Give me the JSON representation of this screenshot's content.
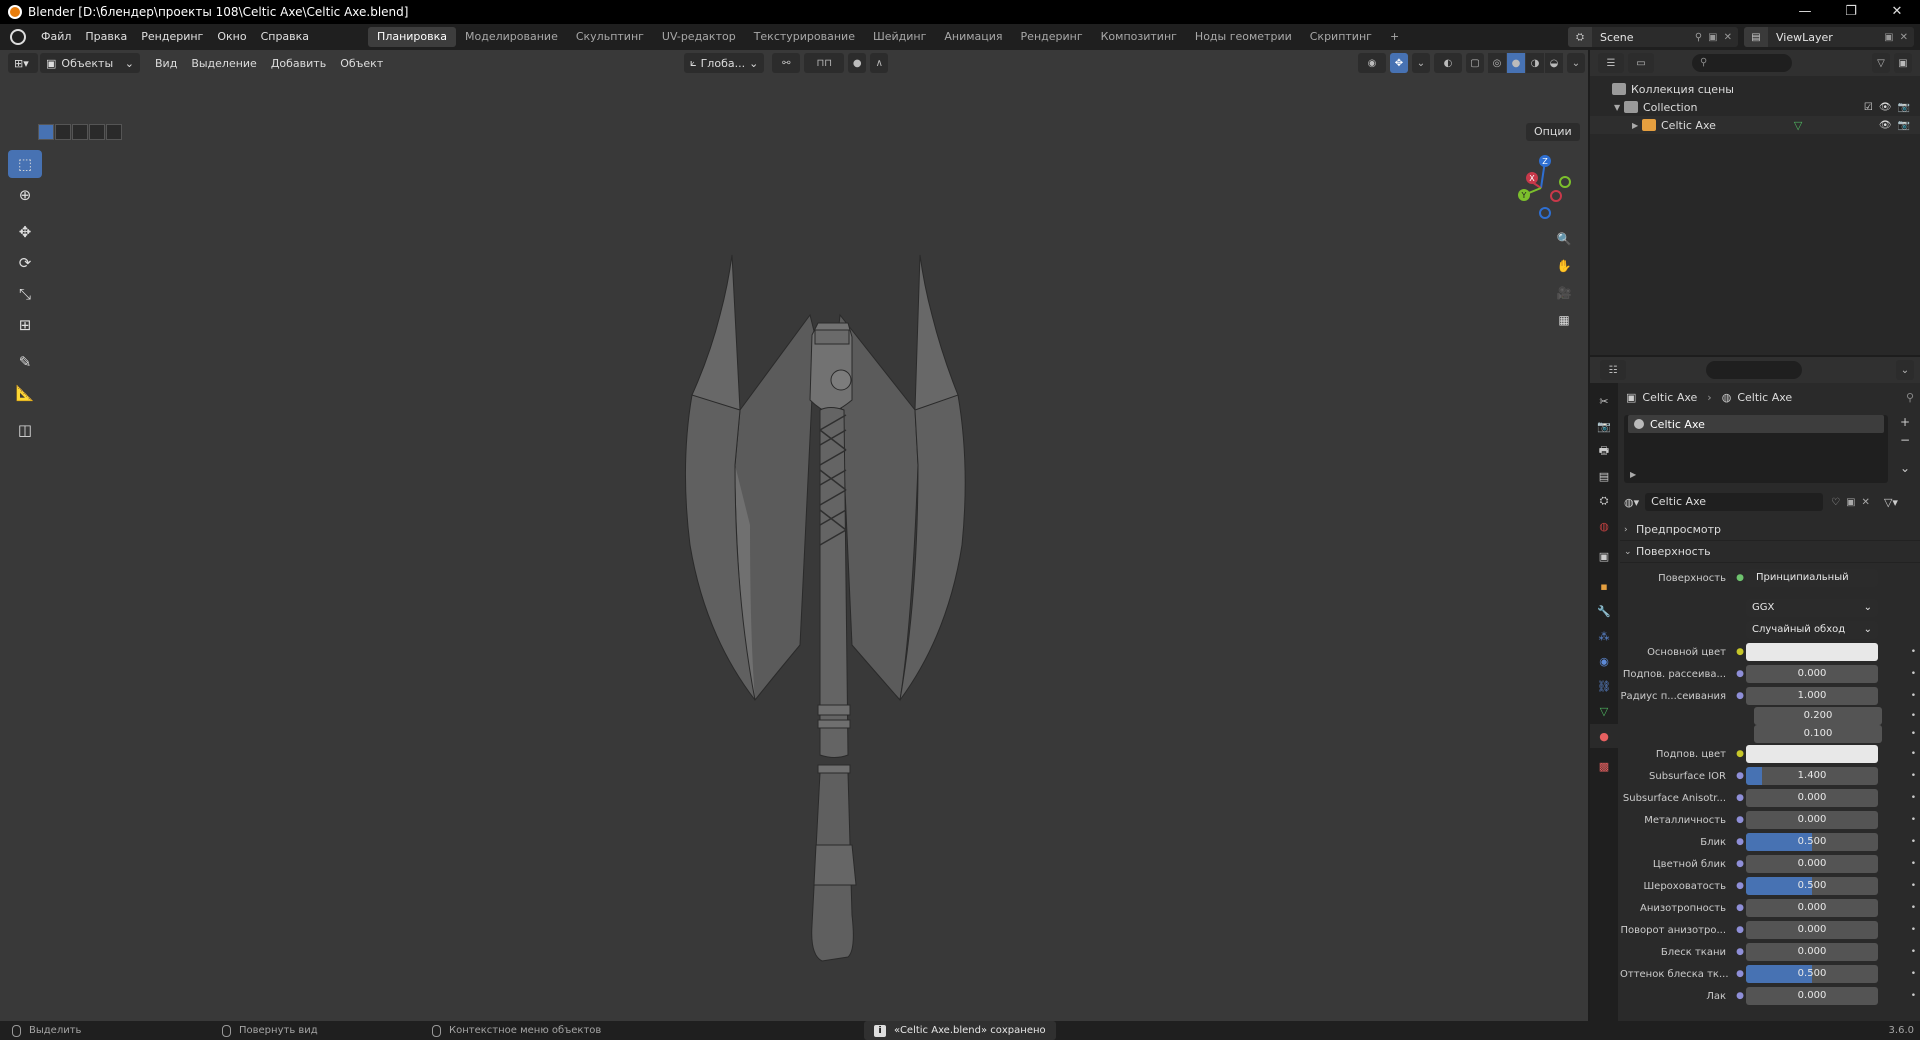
{
  "window": {
    "title": "Blender [D:\\блендер\\проекты 108\\Celtic Axe\\Celtic Axe.blend]",
    "controls": [
      "—",
      "❐",
      "✕"
    ]
  },
  "menu": [
    "Файл",
    "Правка",
    "Рендеринг",
    "Окно",
    "Справка"
  ],
  "workspaces": [
    {
      "label": "Планировка",
      "active": true
    },
    {
      "label": "Моделирование"
    },
    {
      "label": "Скульптинг"
    },
    {
      "label": "UV-редактор"
    },
    {
      "label": "Текстурирование"
    },
    {
      "label": "Шейдинг"
    },
    {
      "label": "Анимация"
    },
    {
      "label": "Рендеринг"
    },
    {
      "label": "Композитинг"
    },
    {
      "label": "Ноды геометрии"
    },
    {
      "label": "Скриптинг"
    }
  ],
  "add_workspace": "+",
  "scene": {
    "label": "Scene"
  },
  "view_layer": {
    "label": "ViewLayer"
  },
  "viewport": {
    "mode": "Объекты",
    "menu": [
      "Вид",
      "Выделение",
      "Добавить",
      "Объект"
    ],
    "orientation": "Глоба...",
    "options": "Опции",
    "gizmo": {
      "x": "X",
      "y": "Y",
      "z": "Z"
    }
  },
  "outliner": {
    "scene_collection": "Коллекция сцены",
    "collection": "Collection",
    "object": "Celtic Axe"
  },
  "properties": {
    "breadcrumb": [
      "Celtic Axe",
      "Celtic Axe"
    ],
    "material_slot": "Celtic Axe",
    "material_name": "Celtic Axe",
    "panels": {
      "preview": "Предпросмотр",
      "surface": "Поверхность"
    },
    "surface_label": "Поверхность",
    "surface_node": "Принципиальный BSDF",
    "distribution": "GGX",
    "subsurface_method": "Случайный обход",
    "rows": [
      {
        "label": "Основной цвет",
        "type": "color",
        "dot": "yel"
      },
      {
        "label": "Подпов. рассеива...",
        "value": "0.000"
      },
      {
        "label": "Радиус п...сеивания",
        "value": "1.000"
      },
      {
        "label": "",
        "value": "0.200",
        "sub": true
      },
      {
        "label": "",
        "value": "0.100",
        "sub": true
      },
      {
        "label": "Подпов. цвет",
        "type": "color",
        "dot": "yel"
      },
      {
        "label": "Subsurface IOR",
        "value": "1.400",
        "fill": 0.12
      },
      {
        "label": "Subsurface Anisotr...",
        "value": "0.000"
      },
      {
        "label": "Металличность",
        "value": "0.000"
      },
      {
        "label": "Блик",
        "value": "0.500",
        "fill": 0.5
      },
      {
        "label": "Цветной блик",
        "value": "0.000"
      },
      {
        "label": "Шероховатость",
        "value": "0.500",
        "fill": 0.5
      },
      {
        "label": "Анизотропность",
        "value": "0.000"
      },
      {
        "label": "Поворот анизотро...",
        "value": "0.000"
      },
      {
        "label": "Блеск ткани",
        "value": "0.000"
      },
      {
        "label": "Оттенок блеска тк...",
        "value": "0.500",
        "fill": 0.5
      },
      {
        "label": "Лак",
        "value": "0.000"
      }
    ]
  },
  "status": {
    "select": "Выделить",
    "rotate": "Повернуть вид",
    "context": "Контекстное меню объектов",
    "message": "«Celtic Axe.blend» сохранено",
    "version": "3.6.0"
  }
}
